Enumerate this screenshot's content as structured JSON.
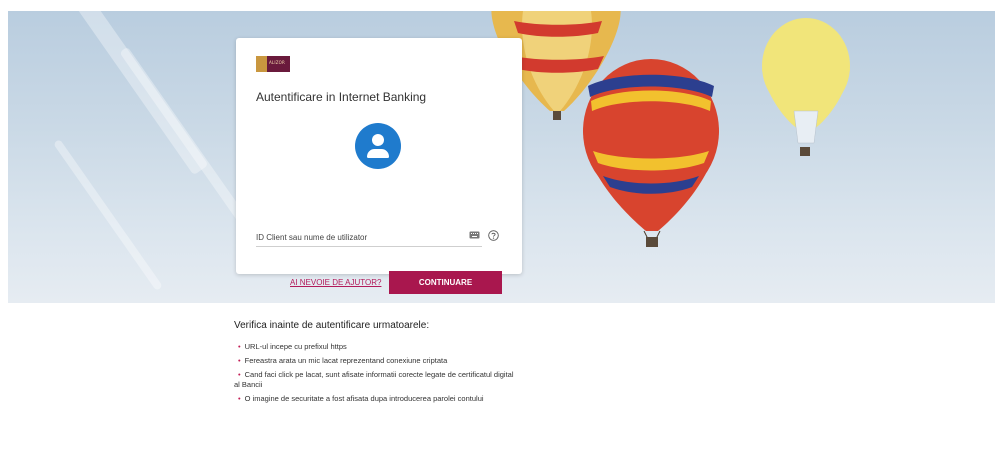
{
  "login": {
    "title": "Autentificare in Internet Banking",
    "logo_text": "ALIZOR",
    "id_placeholder": "ID Client sau nume de utilizator",
    "help_link": "AI NEVOIE DE AJUTOR?",
    "continue_button": "CONTINUARE"
  },
  "verification": {
    "heading": "Verifica inainte de autentificare urmatoarele:",
    "items": [
      "URL-ul incepe cu prefixul https",
      "Fereastra arata un mic lacat reprezentand conexiune criptata",
      "Cand faci click pe lacat, sunt afisate informatii corecte legate de certificatul digital al Bancii",
      "O imagine de securitate a fost afisata dupa introducerea parolei contului"
    ]
  },
  "colors": {
    "brand": "#a9174e",
    "avatar": "#1f7bcd",
    "bullet": "#c21d55"
  },
  "icons": [
    "user-icon",
    "keyboard-icon",
    "help-icon"
  ]
}
